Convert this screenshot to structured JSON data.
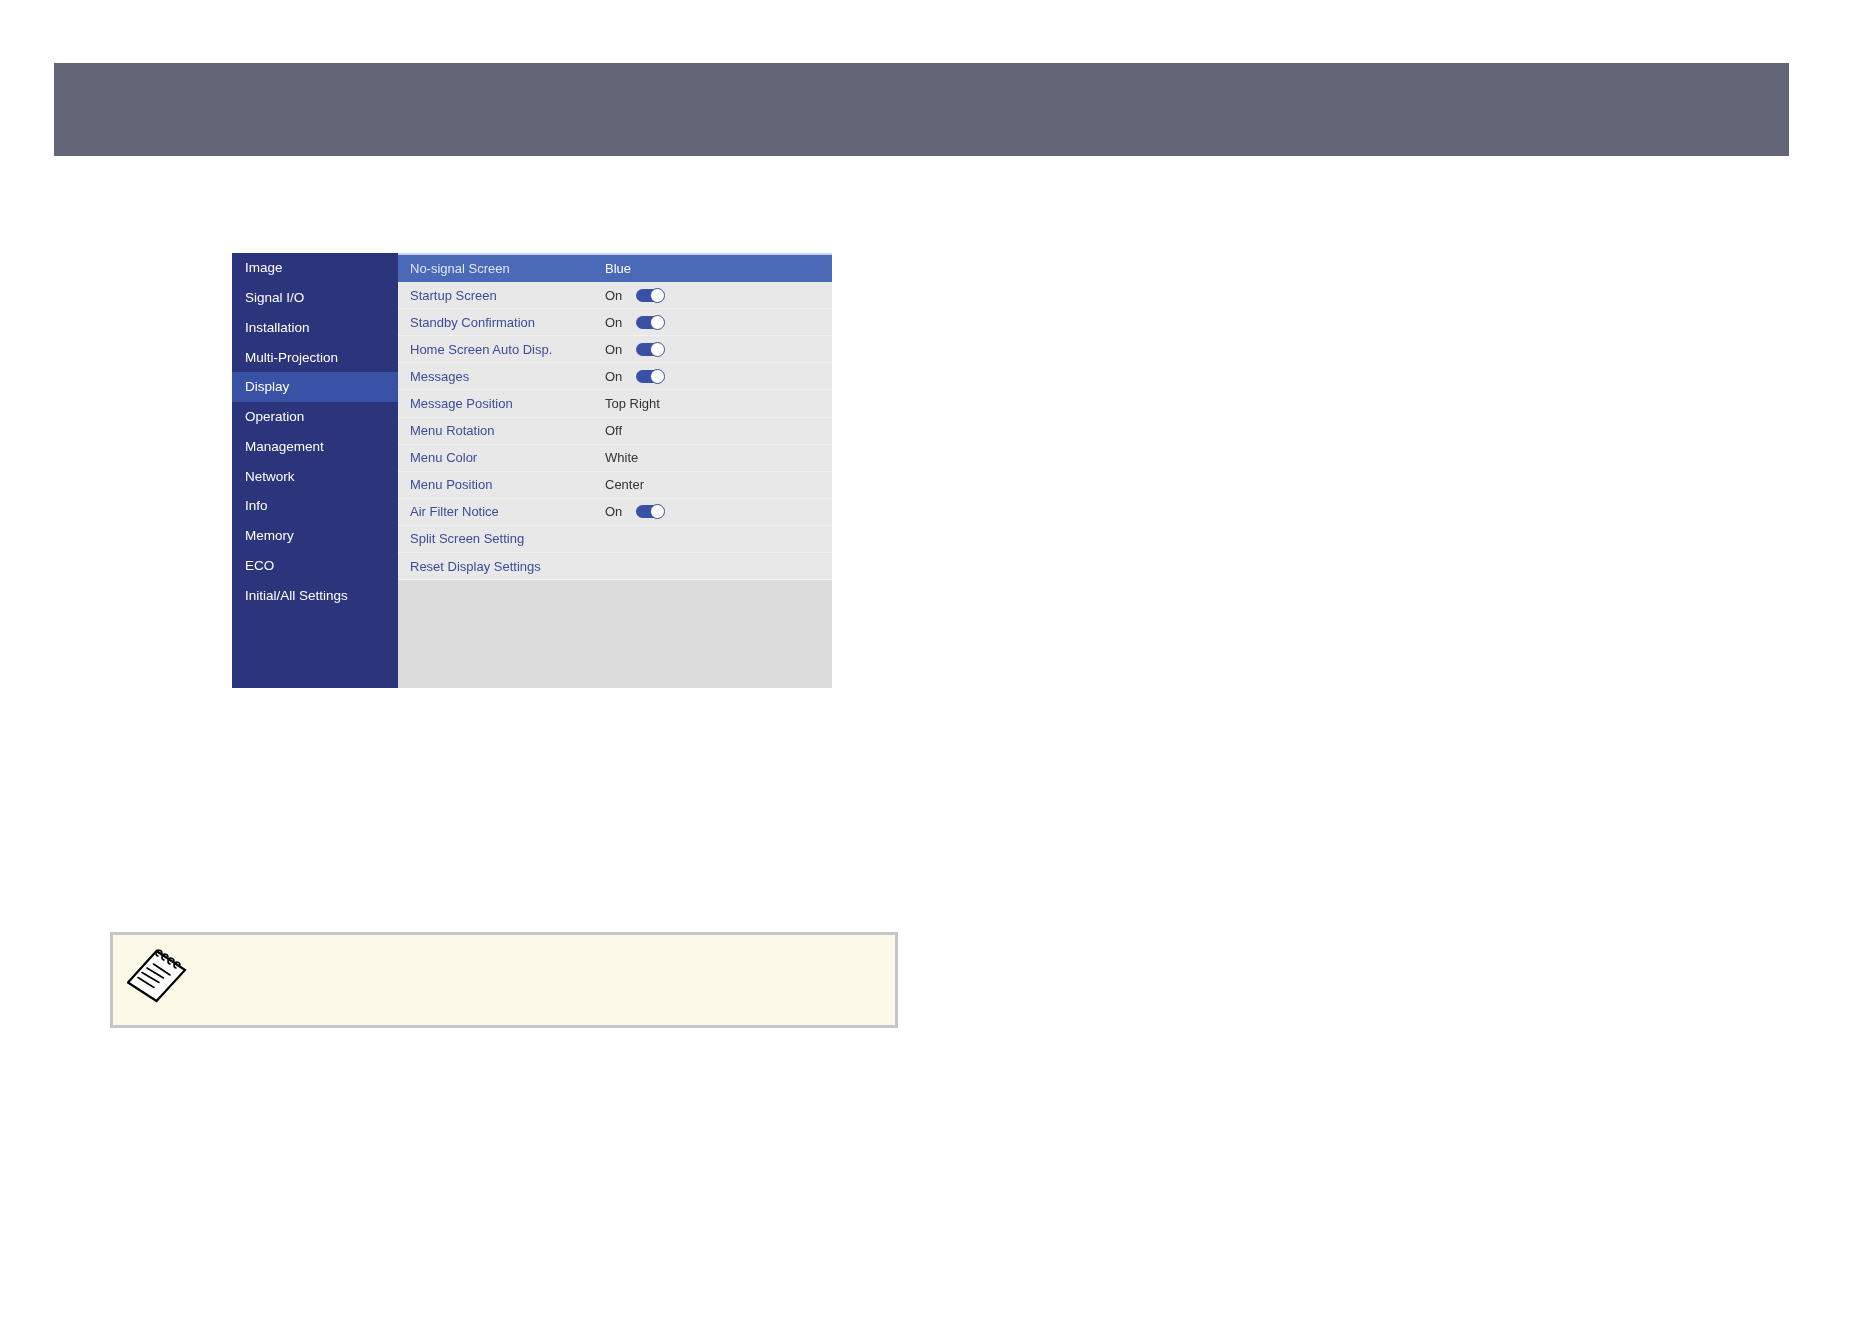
{
  "menu": {
    "categories": [
      {
        "label": "Image",
        "selected": false
      },
      {
        "label": "Signal I/O",
        "selected": false
      },
      {
        "label": "Installation",
        "selected": false
      },
      {
        "label": "Multi-Projection",
        "selected": false
      },
      {
        "label": "Display",
        "selected": true
      },
      {
        "label": "Operation",
        "selected": false
      },
      {
        "label": "Management",
        "selected": false
      },
      {
        "label": "Network",
        "selected": false
      },
      {
        "label": "Info",
        "selected": false
      },
      {
        "label": "Memory",
        "selected": false
      },
      {
        "label": "ECO",
        "selected": false
      },
      {
        "label": "Initial/All Settings",
        "selected": false
      }
    ],
    "settings": [
      {
        "kind": "option",
        "label": "No-signal Screen",
        "value": "Blue",
        "selected": true
      },
      {
        "kind": "toggle",
        "label": "Startup Screen",
        "value": "On",
        "on": true,
        "selected": false
      },
      {
        "kind": "toggle",
        "label": "Standby Confirmation",
        "value": "On",
        "on": true,
        "selected": false
      },
      {
        "kind": "toggle",
        "label": "Home Screen Auto Disp.",
        "value": "On",
        "on": true,
        "selected": false
      },
      {
        "kind": "toggle",
        "label": "Messages",
        "value": "On",
        "on": true,
        "selected": false
      },
      {
        "kind": "option",
        "label": "Message Position",
        "value": "Top Right",
        "selected": false
      },
      {
        "kind": "option",
        "label": "Menu Rotation",
        "value": "Off",
        "selected": false
      },
      {
        "kind": "option",
        "label": "Menu Color",
        "value": "White",
        "selected": false
      },
      {
        "kind": "option",
        "label": "Menu Position",
        "value": "Center",
        "selected": false
      },
      {
        "kind": "toggle",
        "label": "Air Filter Notice",
        "value": "On",
        "on": true,
        "selected": false
      },
      {
        "kind": "submenu",
        "label": "Split Screen Setting",
        "selected": false
      },
      {
        "kind": "submenu",
        "label": "Reset Display Settings",
        "selected": false
      }
    ]
  }
}
